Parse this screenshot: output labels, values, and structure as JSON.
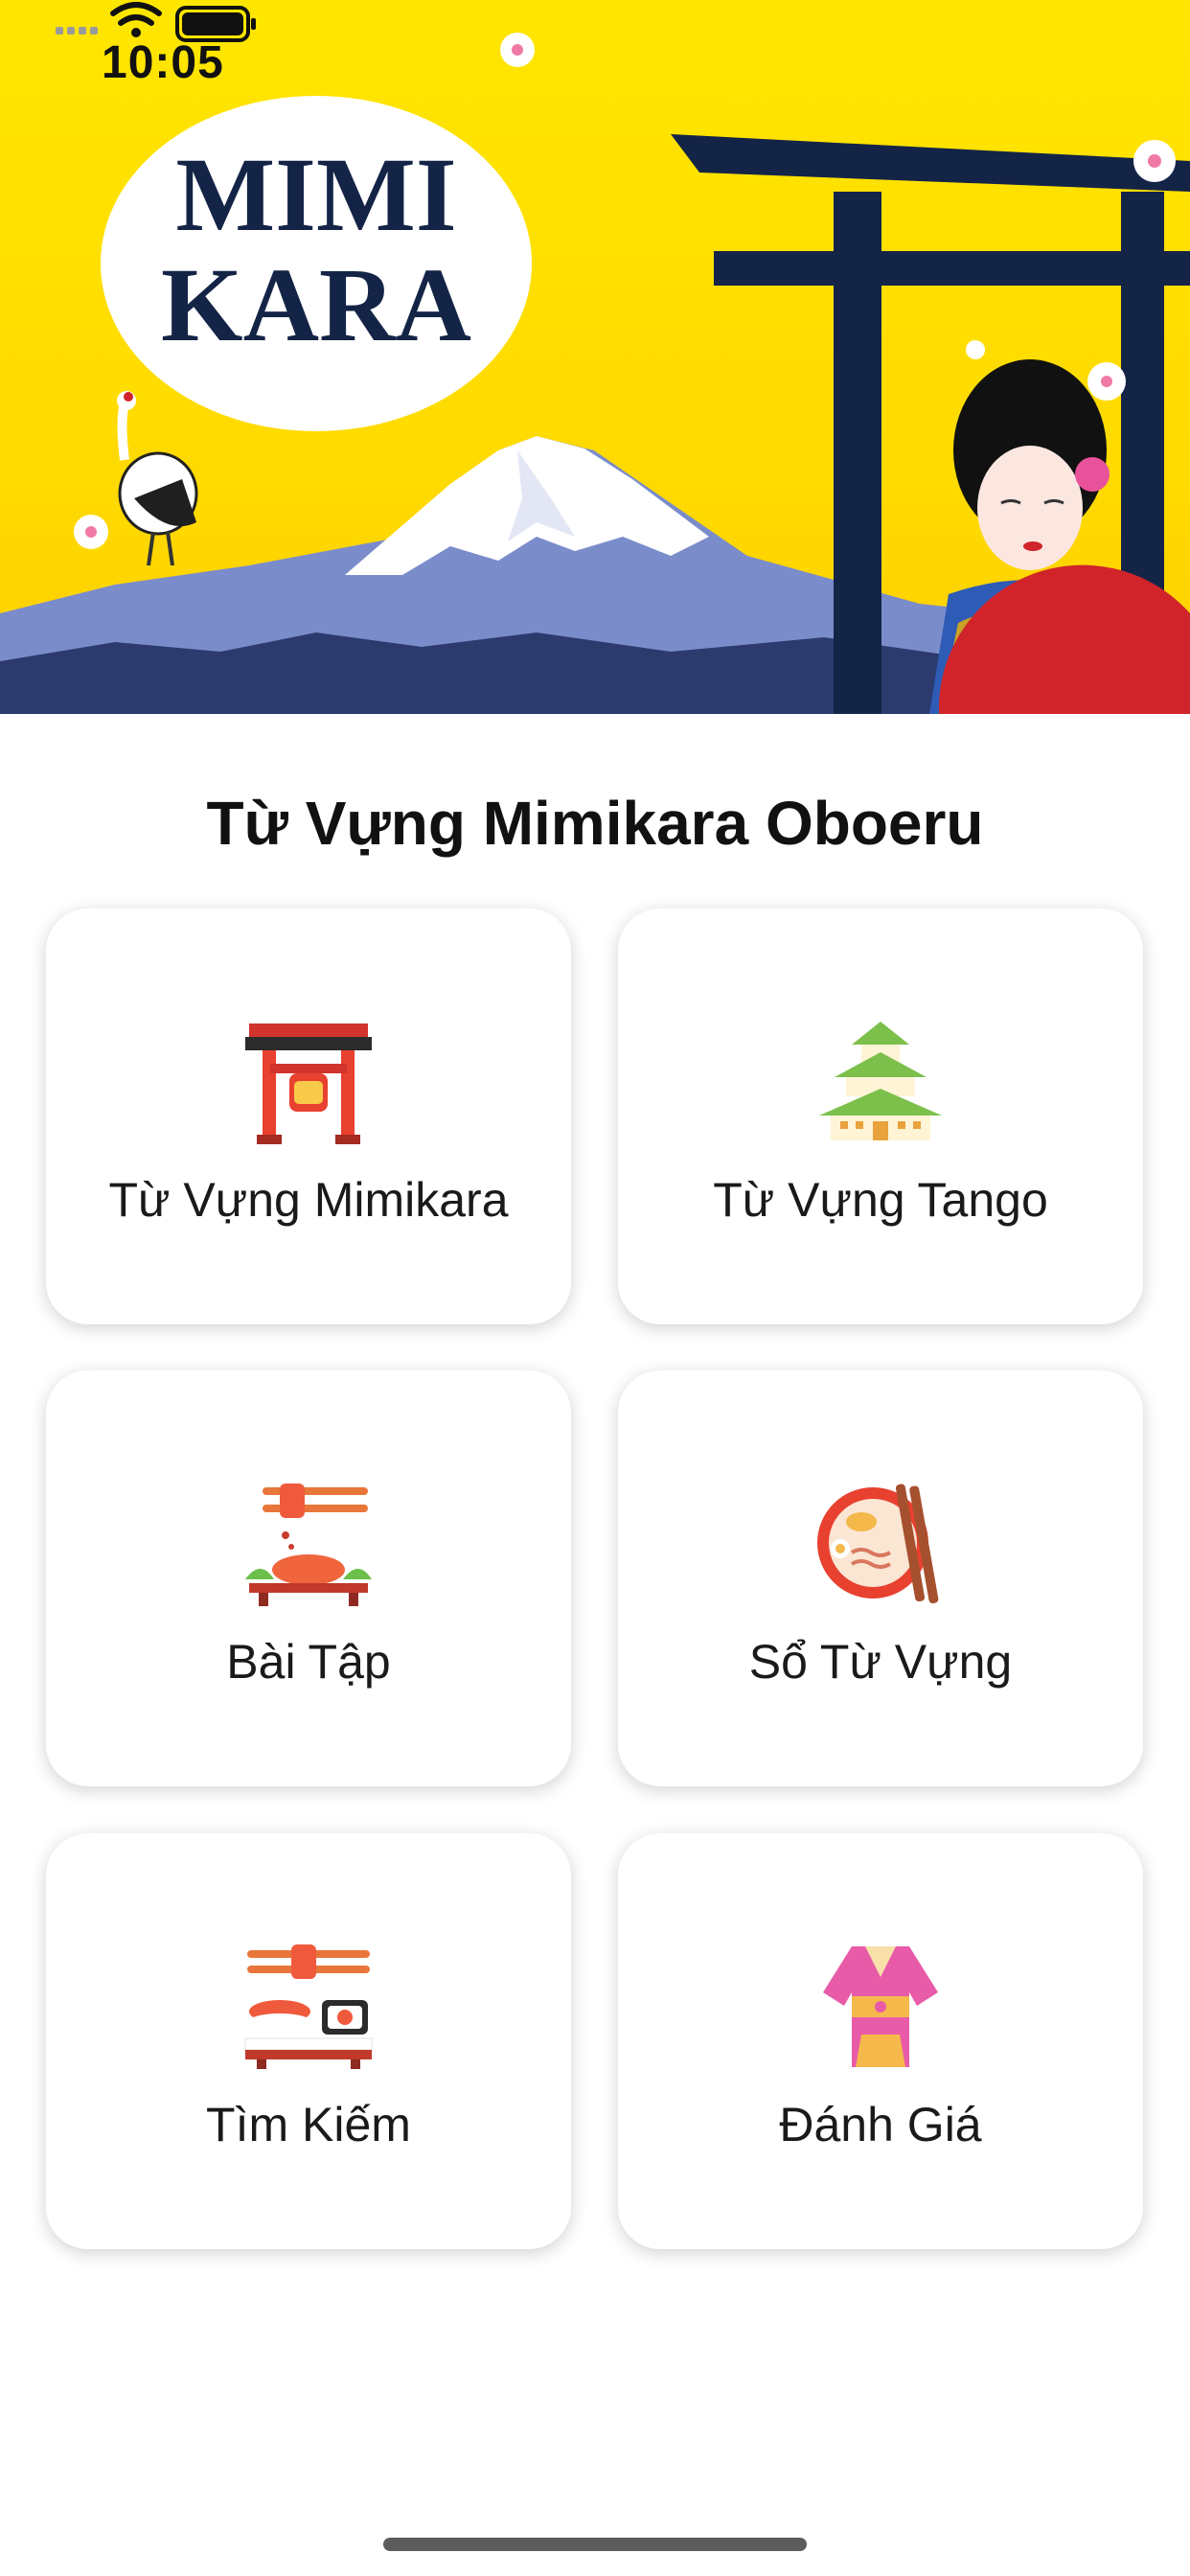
{
  "status_bar": {
    "time": "10:05"
  },
  "banner": {
    "logo_line1": "MIMI",
    "logo_line2": "KARA"
  },
  "main": {
    "title": "Từ Vựng Mimikara Oboeru",
    "tiles": [
      {
        "label": "Từ Vựng Mimikara",
        "icon": "torii-gate-icon"
      },
      {
        "label": "Từ Vựng Tango",
        "icon": "pagoda-castle-icon"
      },
      {
        "label": "Bài Tập",
        "icon": "sushi-chopsticks-icon"
      },
      {
        "label": "Sổ Từ Vựng",
        "icon": "ramen-bowl-icon"
      },
      {
        "label": "Tìm Kiếm",
        "icon": "sushi-plate-icon"
      },
      {
        "label": "Đánh Giá",
        "icon": "kimono-icon"
      }
    ]
  },
  "colors": {
    "banner_yellow": "#FFE000",
    "torii_navy": "#142447",
    "mountain_blue": "#6C7FC0"
  }
}
